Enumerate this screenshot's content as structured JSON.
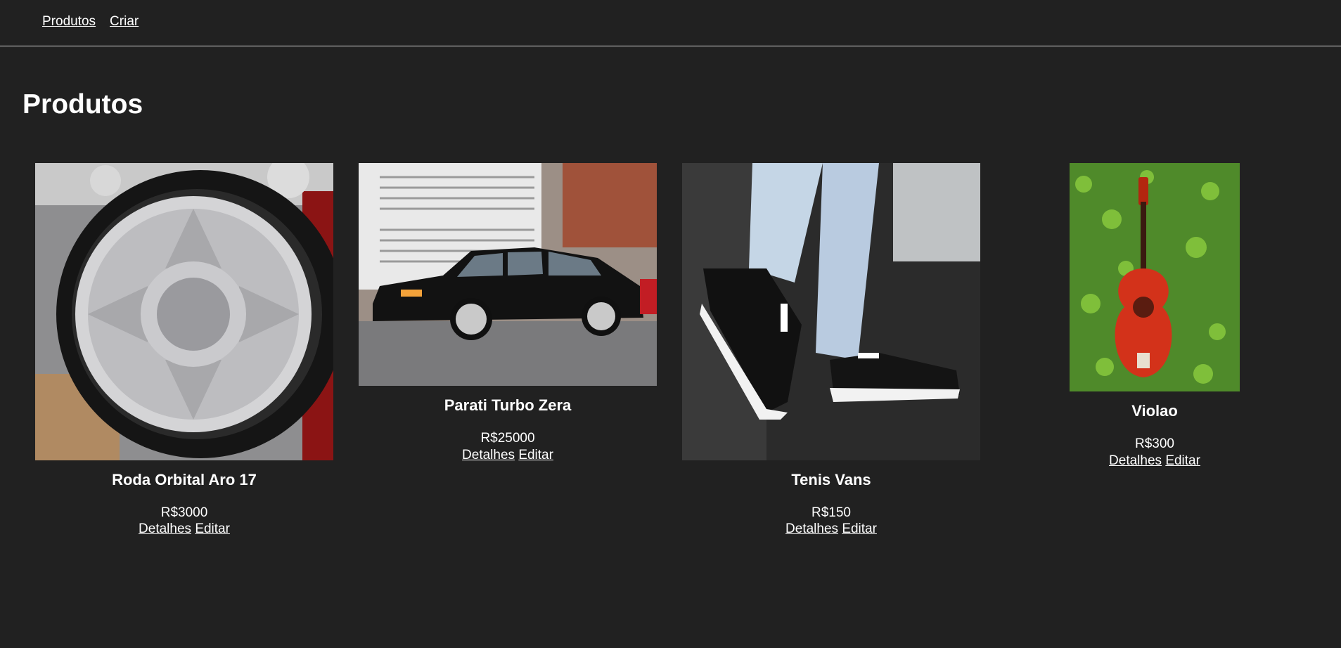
{
  "nav": {
    "items": [
      {
        "label": "Produtos"
      },
      {
        "label": "Criar"
      }
    ]
  },
  "page": {
    "title": "Produtos"
  },
  "products": [
    {
      "name": "Roda Orbital Aro 17",
      "price": "R$3000",
      "details_label": "Detalhes",
      "edit_label": "Editar",
      "image": "wheel-photo"
    },
    {
      "name": "Parati Turbo Zera",
      "price": "R$25000",
      "details_label": "Detalhes",
      "edit_label": "Editar",
      "image": "car-photo"
    },
    {
      "name": "Tenis Vans",
      "price": "R$150",
      "details_label": "Detalhes",
      "edit_label": "Editar",
      "image": "sneakers-photo"
    },
    {
      "name": "Violao",
      "price": "R$300",
      "details_label": "Detalhes",
      "edit_label": "Editar",
      "image": "guitar-photo"
    }
  ],
  "colors": {
    "background": "#212121",
    "text": "#ffffff",
    "divider": "#d8d8d8"
  }
}
